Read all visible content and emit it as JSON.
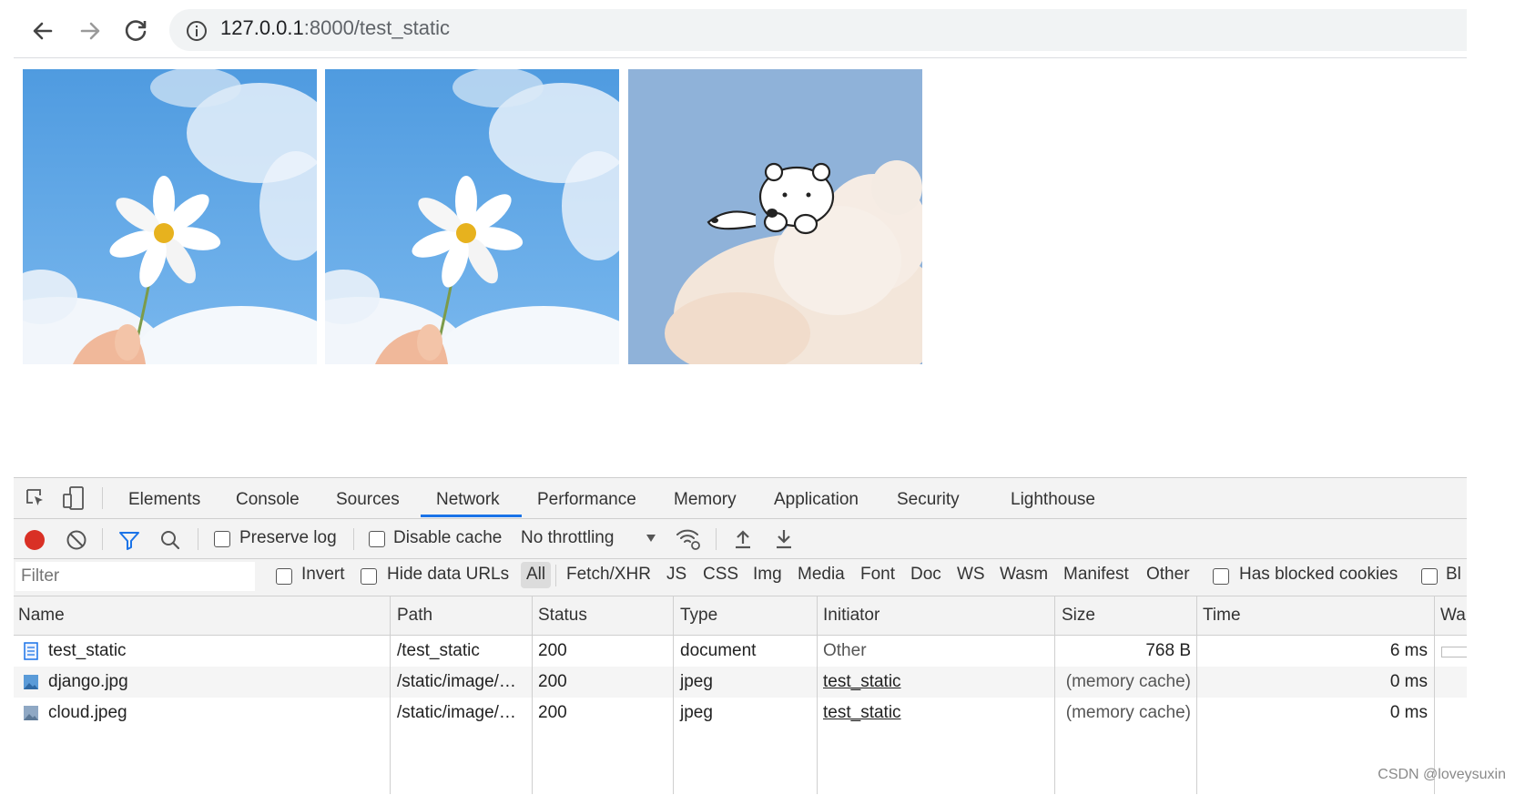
{
  "browser": {
    "url_host": "127.0.0.1",
    "url_rest": ":8000/test_static"
  },
  "devtools": {
    "tabs": [
      "Elements",
      "Console",
      "Sources",
      "Network",
      "Performance",
      "Memory",
      "Application",
      "Security",
      "Lighthouse"
    ],
    "active_tab": "Network",
    "toolbar": {
      "preserve_log": "Preserve log",
      "disable_cache": "Disable cache",
      "throttling": "No throttling"
    },
    "filter_bar": {
      "placeholder": "Filter",
      "invert": "Invert",
      "hide_data_urls": "Hide data URLs",
      "types": [
        "All",
        "Fetch/XHR",
        "JS",
        "CSS",
        "Img",
        "Media",
        "Font",
        "Doc",
        "WS",
        "Wasm",
        "Manifest",
        "Other"
      ],
      "has_blocked_cookies": "Has blocked cookies",
      "blocked_truncated": "Bl"
    },
    "columns": [
      "Name",
      "Path",
      "Status",
      "Type",
      "Initiator",
      "Size",
      "Time",
      "Wa"
    ],
    "rows": [
      {
        "name": "test_static",
        "path": "/test_static",
        "status": "200",
        "type": "document",
        "initiator": "Other",
        "size": "768 B",
        "time": "6 ms"
      },
      {
        "name": "django.jpg",
        "path": "/static/image/…",
        "status": "200",
        "type": "jpeg",
        "initiator": "test_static",
        "size": "(memory cache)",
        "time": "0 ms"
      },
      {
        "name": "cloud.jpeg",
        "path": "/static/image/…",
        "status": "200",
        "type": "jpeg",
        "initiator": "test_static",
        "size": "(memory cache)",
        "time": "0 ms"
      }
    ]
  },
  "watermark": "CSDN @loveysuxin"
}
